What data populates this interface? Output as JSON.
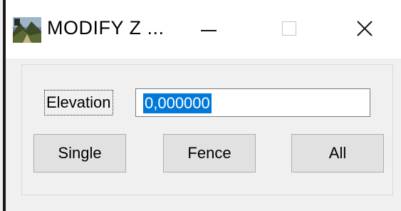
{
  "window": {
    "title": "MODIFY Z ...",
    "icon": "landscape-app-icon",
    "controls": {
      "minimize": "minimize-icon",
      "maximize": "maximize-icon",
      "close": "close-icon"
    }
  },
  "form": {
    "elevation_label": "Elevation",
    "elevation_value": "0,000000"
  },
  "buttons": {
    "single": "Single",
    "fence": "Fence",
    "all": "All"
  },
  "colors": {
    "selection": "#0078d7",
    "button_face": "#e1e1e1",
    "window_bg": "#f0f0f0"
  }
}
